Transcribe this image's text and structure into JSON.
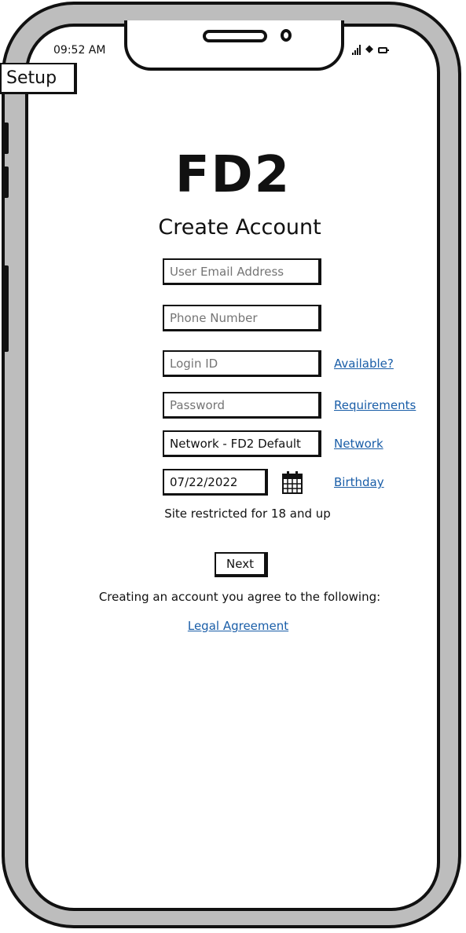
{
  "status_bar": {
    "time": "09:52 AM",
    "icons": [
      "signal-icon",
      "wifi-icon",
      "battery-icon"
    ]
  },
  "screen_tab": {
    "label": "Setup"
  },
  "header": {
    "app_name": "FD2",
    "title": "Create Account"
  },
  "form": {
    "email": {
      "placeholder": "User Email Address"
    },
    "phone": {
      "placeholder": "Phone Number"
    },
    "login_id": {
      "placeholder": "Login ID",
      "link": "Available?"
    },
    "password": {
      "placeholder": "Password",
      "link": "Requirements"
    },
    "network": {
      "value": "Network - FD2 Default",
      "link": "Network"
    },
    "birthday": {
      "value": "07/22/2022",
      "link": "Birthday",
      "icon": "calendar-icon"
    },
    "age_note": "Site restricted for 18 and up",
    "next_label": "Next"
  },
  "footer": {
    "agreement_note": "Creating an account you agree to the following:",
    "legal_link": "Legal Agreement"
  },
  "colors": {
    "link": "#1a5ea8",
    "frame": "#bdbdbd",
    "ink": "#111111"
  }
}
